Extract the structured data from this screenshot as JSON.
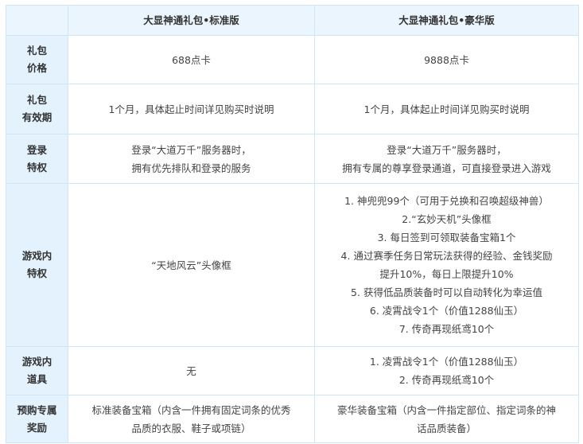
{
  "header": {
    "corner": "",
    "col_standard": "大显神通礼包•标准版",
    "col_deluxe": "大显神通礼包•豪华版"
  },
  "rows": [
    {
      "label": [
        "礼包",
        "价格"
      ],
      "standard": [
        "688点卡"
      ],
      "deluxe": [
        "9888点卡"
      ]
    },
    {
      "label": [
        "礼包",
        "有效期"
      ],
      "standard": [
        "1个月，具体起止时间详见购买时说明"
      ],
      "deluxe": [
        "1个月，具体起止时间详见购买时说明"
      ]
    },
    {
      "label": [
        "登录",
        "特权"
      ],
      "standard": [
        "登录“大道万千”服务器时，",
        "拥有优先排队和登录的服务"
      ],
      "deluxe": [
        "登录“大道万千”服务器时，",
        "拥有专属的尊享登录通道，可直接登录进入游戏"
      ]
    },
    {
      "label": [
        "游戏内",
        "特权"
      ],
      "standard": [
        "“天地风云”头像框"
      ],
      "deluxe": [
        "1. 神兜兜99个（可用于兑换和召唤超级神兽）",
        "2.“玄妙天机”头像框",
        "3. 每日签到可领取装备宝箱1个",
        "4. 通过赛季任务日常玩法获得的经验、金钱奖励",
        "提升10%，每日上限提升10%",
        "5. 获得低品质装备时可以自动转化为幸运值",
        "6. 凌霄战令1个（价值1288仙玉）",
        "7. 传奇再现纸鸢10个"
      ]
    },
    {
      "label": [
        "游戏内",
        "道具"
      ],
      "standard": [
        "无"
      ],
      "deluxe": [
        "1. 凌霄战令1个（价值1288仙玉）",
        "2. 传奇再现纸鸢10个"
      ]
    },
    {
      "label": [
        "预购专属",
        "奖励"
      ],
      "standard": [
        "标准装备宝箱（内含一件拥有固定词条的优秀",
        "品质的衣服、鞋子或项链）"
      ],
      "deluxe": [
        "豪华装备宝箱（内含一件指定部位、指定词条的神",
        "话品质装备）"
      ]
    }
  ]
}
